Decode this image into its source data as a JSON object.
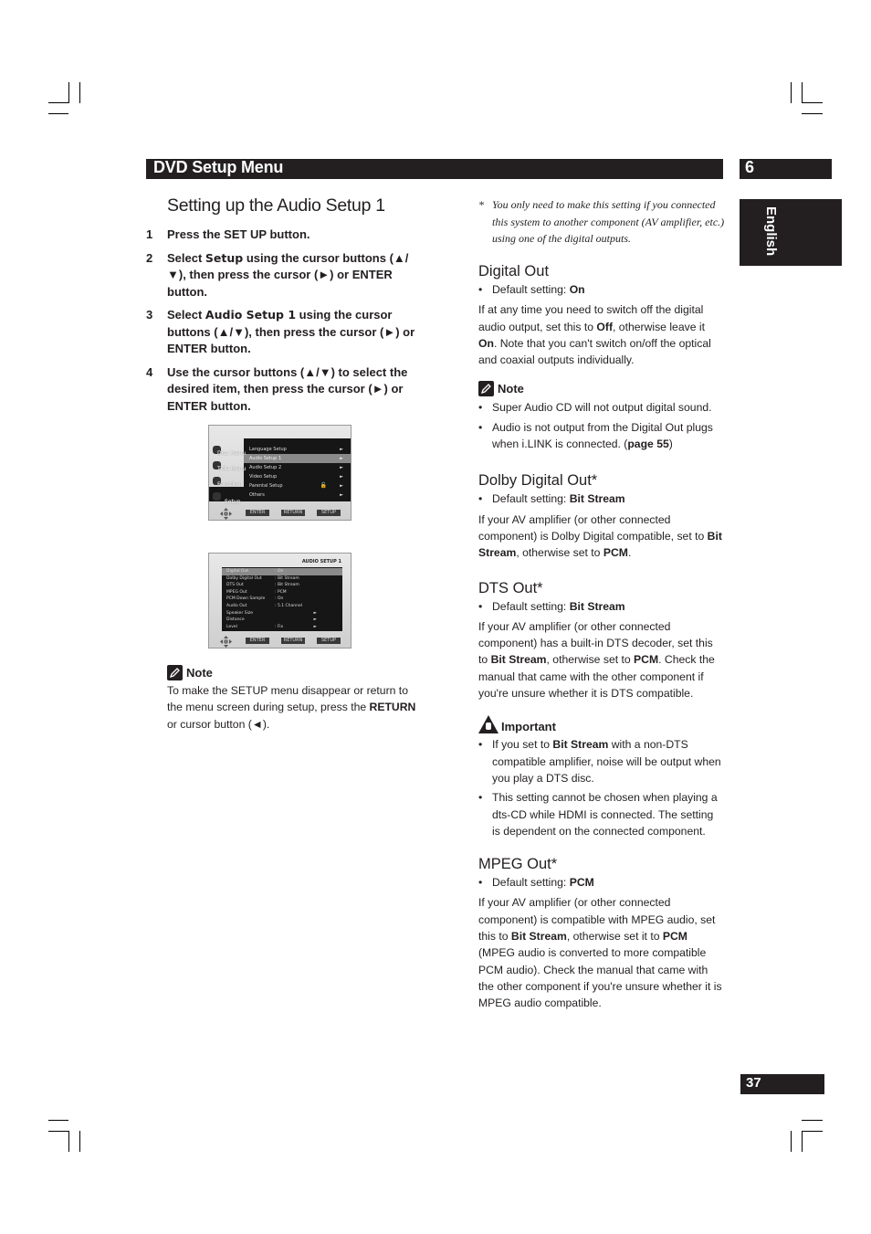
{
  "header": {
    "section_title": "DVD Setup Menu",
    "chapter_number": "6",
    "language_tab": "English",
    "page_number": "37"
  },
  "left": {
    "title": "Setting up the Audio Setup 1",
    "steps": [
      {
        "num": "1",
        "parts": [
          {
            "t": "Press the SET UP button."
          }
        ]
      },
      {
        "num": "2",
        "parts": [
          {
            "t": "Select "
          },
          {
            "t": "Setup",
            "b": true
          },
          {
            "t": " using the cursor buttons (▲/▼), then press the cursor (►) or ENTER button."
          }
        ]
      },
      {
        "num": "3",
        "parts": [
          {
            "t": "Select "
          },
          {
            "t": "Audio Setup 1",
            "b": true
          },
          {
            "t": " using the cursor buttons (▲/▼), then press the cursor (►) or ENTER button."
          }
        ]
      },
      {
        "num": "4",
        "parts": [
          {
            "t": "Use the cursor buttons (▲/▼) to select the desired item, then press the cursor (►) or ENTER button."
          }
        ]
      }
    ],
    "screen1": {
      "side_items": [
        "Disc Menu",
        "Title Menu",
        "Function",
        "Setup"
      ],
      "menu_items": [
        "Language Setup",
        "Audio Setup 1",
        "Audio Setup 2",
        "Video Setup",
        "Parental Setup",
        "Others"
      ],
      "selected_index": 1,
      "buttons": [
        "ENTER",
        "RETURN",
        "SETUP"
      ]
    },
    "screen2": {
      "title": "AUDIO SETUP 1",
      "rows": [
        {
          "label": "Digital Out",
          "value": ": On",
          "arrow": ""
        },
        {
          "label": "Dolby Digital Out",
          "value": ": Bit Stream",
          "arrow": ""
        },
        {
          "label": "DTS Out",
          "value": ": Bit Stream",
          "arrow": ""
        },
        {
          "label": "MPEG Out",
          "value": ": PCM",
          "arrow": ""
        },
        {
          "label": "PCM Down Sample",
          "value": ": On",
          "arrow": ""
        },
        {
          "label": "Audio Out",
          "value": ": 5.1 Channel",
          "arrow": ""
        },
        {
          "label": "Speaker Size",
          "value": "",
          "arrow": "►"
        },
        {
          "label": "Distance",
          "value": "",
          "arrow": "►"
        },
        {
          "label": "Level",
          "value": ": Fix",
          "arrow": "►"
        }
      ],
      "selected_index": 0,
      "buttons": [
        "ENTER",
        "RETURN",
        "SETUP"
      ]
    },
    "note": {
      "heading": "Note",
      "parts": [
        {
          "t": "To make the SETUP menu disappear or return to the menu screen during setup, press the "
        },
        {
          "t": "RETURN",
          "b": true
        },
        {
          "t": " or cursor button (◄)."
        }
      ]
    }
  },
  "right": {
    "footnote": "You only need to make this setting if you connected this system to another component (AV amplifier, etc.) using one of the digital outputs.",
    "footnote_mark": "*",
    "sections": [
      {
        "id": "digital-out",
        "title": "Digital Out",
        "default_label": "Default setting: ",
        "default_value": "On",
        "body": [
          {
            "t": "If at any time you need to switch off the digital audio output, set this to "
          },
          {
            "t": "Off",
            "b": true
          },
          {
            "t": ", otherwise leave it "
          },
          {
            "t": "On",
            "b": true
          },
          {
            "t": ". Note that you can't switch on/off the optical and coaxial outputs individually."
          }
        ],
        "note": {
          "heading": "Note",
          "bullets": [
            [
              {
                "t": "Super Audio CD will not output digital sound."
              }
            ],
            [
              {
                "t": "Audio is not output from the Digital Out plugs when i.LINK is connected. ("
              },
              {
                "t": "page 55",
                "b": true
              },
              {
                "t": ")"
              }
            ]
          ]
        }
      },
      {
        "id": "dolby-digital-out",
        "title": "Dolby Digital Out*",
        "default_label": "Default setting: ",
        "default_value": "Bit Stream",
        "body": [
          {
            "t": "If your AV amplifier (or other connected component) is Dolby Digital compatible, set to "
          },
          {
            "t": "Bit Stream",
            "b": true
          },
          {
            "t": ", otherwise set to "
          },
          {
            "t": "PCM",
            "b": true
          },
          {
            "t": "."
          }
        ]
      },
      {
        "id": "dts-out",
        "title": "DTS Out*",
        "default_label": "Default setting: ",
        "default_value": "Bit Stream",
        "body": [
          {
            "t": "If your AV amplifier (or other connected component) has a built-in DTS decoder, set this to "
          },
          {
            "t": "Bit Stream",
            "b": true
          },
          {
            "t": ", otherwise set to "
          },
          {
            "t": "PCM",
            "b": true
          },
          {
            "t": ". Check the manual that came with the other component if you're unsure whether it is DTS compatible."
          }
        ],
        "important": {
          "heading": "Important",
          "bullets": [
            [
              {
                "t": "If you set to "
              },
              {
                "t": "Bit Stream",
                "b": true
              },
              {
                "t": " with a non-DTS compatible amplifier, noise will be output when you play a DTS disc."
              }
            ],
            [
              {
                "t": "This setting cannot be chosen when playing a dts-CD while HDMI is connected. The setting is dependent on the connected component."
              }
            ]
          ]
        }
      },
      {
        "id": "mpeg-out",
        "title": "MPEG Out*",
        "default_label": "Default setting: ",
        "default_value": "PCM",
        "body": [
          {
            "t": "If your AV amplifier (or other connected component) is compatible with MPEG audio, set this to "
          },
          {
            "t": "Bit Stream",
            "b": true
          },
          {
            "t": ", otherwise set it to "
          },
          {
            "t": "PCM",
            "b": true
          },
          {
            "t": " (MPEG audio is converted to more compatible PCM audio). Check the manual that came with the other component if you're unsure whether it is MPEG audio compatible."
          }
        ]
      }
    ]
  }
}
